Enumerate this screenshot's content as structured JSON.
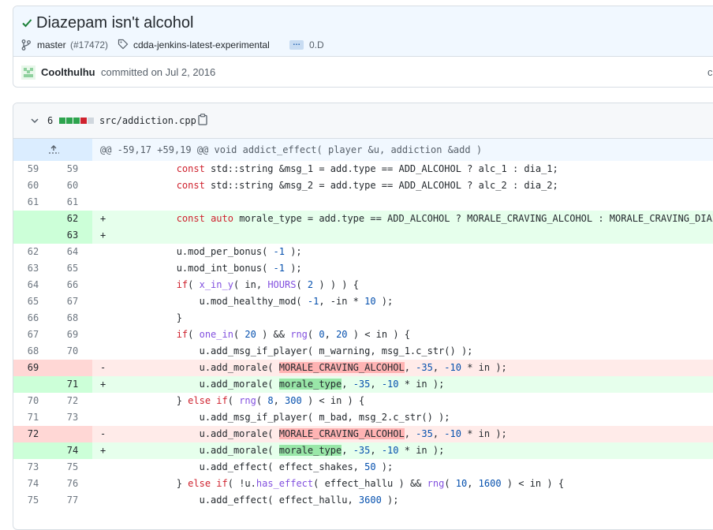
{
  "commit": {
    "title": "Diazepam isn't alcohol",
    "branch": "master",
    "pr": "(#17472)",
    "tag": "cdda-jenkins-latest-experimental",
    "ellipsis": "…",
    "version": "0.D",
    "author": "Coolthulhu",
    "committed_text": "committed on Jul 2, 2016",
    "cut_text": "co"
  },
  "file": {
    "change_count": "6",
    "path": "src/addiction.cpp",
    "diffstat": [
      "add",
      "add",
      "add",
      "del",
      "neutral"
    ]
  },
  "hunk": {
    "header": "@@ -59,17 +59,19 @@ void addict_effect( player &u, addiction &add )"
  },
  "lines": [
    {
      "old": "59",
      "new": "59",
      "type": "ctx",
      "marker": ""
    },
    {
      "old": "60",
      "new": "60",
      "type": "ctx",
      "marker": ""
    },
    {
      "old": "61",
      "new": "61",
      "type": "ctx",
      "marker": ""
    },
    {
      "old": "",
      "new": "62",
      "type": "add",
      "marker": "+"
    },
    {
      "old": "",
      "new": "63",
      "type": "add",
      "marker": "+"
    },
    {
      "old": "62",
      "new": "64",
      "type": "ctx",
      "marker": ""
    },
    {
      "old": "63",
      "new": "65",
      "type": "ctx",
      "marker": ""
    },
    {
      "old": "64",
      "new": "66",
      "type": "ctx",
      "marker": ""
    },
    {
      "old": "65",
      "new": "67",
      "type": "ctx",
      "marker": ""
    },
    {
      "old": "66",
      "new": "68",
      "type": "ctx",
      "marker": ""
    },
    {
      "old": "67",
      "new": "69",
      "type": "ctx",
      "marker": ""
    },
    {
      "old": "68",
      "new": "70",
      "type": "ctx",
      "marker": ""
    },
    {
      "old": "69",
      "new": "",
      "type": "del",
      "marker": "-"
    },
    {
      "old": "",
      "new": "71",
      "type": "add",
      "marker": "+"
    },
    {
      "old": "70",
      "new": "72",
      "type": "ctx",
      "marker": ""
    },
    {
      "old": "71",
      "new": "73",
      "type": "ctx",
      "marker": ""
    },
    {
      "old": "72",
      "new": "",
      "type": "del",
      "marker": "-"
    },
    {
      "old": "",
      "new": "74",
      "type": "add",
      "marker": "+"
    },
    {
      "old": "73",
      "new": "75",
      "type": "ctx",
      "marker": ""
    },
    {
      "old": "74",
      "new": "76",
      "type": "ctx",
      "marker": ""
    },
    {
      "old": "75",
      "new": "77",
      "type": "ctx",
      "marker": ""
    }
  ],
  "code": {
    "l0": {
      "indent": "            ",
      "kw": "const",
      "rest": " std::string &msg_1 = add.type == ADD_ALCOHOL ? alc_1 : dia_1;"
    },
    "l1": {
      "indent": "            ",
      "kw": "const",
      "rest": " std::string &msg_2 = add.type == ADD_ALCOHOL ? alc_2 : dia_2;"
    },
    "l3": {
      "indent": "            ",
      "kw1": "const",
      "kw2": "auto",
      "rest": " morale_type = add.type == ADD_ALCOHOL ? MORALE_CRAVING_ALCOHOL : MORALE_CRAVING_DIAZEPAM;"
    },
    "l5": {
      "pre": "            u.",
      "fn": "mod_per_bonus",
      "mid": "( ",
      "n1": "-1",
      "post": " );"
    },
    "l6": {
      "pre": "            u.",
      "fn": "mod_int_bonus",
      "mid": "( ",
      "n1": "-1",
      "post": " );"
    },
    "l7": {
      "indent": "            ",
      "kw": "if",
      "a": "( ",
      "fn": "x_in_y",
      "b": "( in, ",
      "fn2": "HOURS",
      "c": "( ",
      "n1": "2",
      "d": " ) ) ) {"
    },
    "l8": {
      "pre": "                u.",
      "fn": "mod_healthy_mod",
      "a": "( ",
      "n1": "-1",
      "b": ", -in * ",
      "n2": "10",
      "c": " );"
    },
    "l9": {
      "text": "            }"
    },
    "l10": {
      "indent": "            ",
      "kw": "if",
      "a": "( ",
      "fn": "one_in",
      "b": "( ",
      "n1": "20",
      "c": " ) && ",
      "fn2": "rng",
      "d": "( ",
      "n2": "0",
      "e": ", ",
      "n3": "20",
      "f": " ) < in ) {"
    },
    "l11": {
      "pre": "                u.",
      "fn": "add_msg_if_player",
      "a": "( m_warning, msg_1.",
      "fn2": "c_str",
      "b": "() );"
    },
    "l12": {
      "pre": "                u.",
      "fn": "add_morale",
      "a": "( ",
      "hl": "MORALE_CRAVING_ALCOHOL",
      "b": ", ",
      "n1": "-35",
      "c": ", ",
      "n2": "-10",
      "d": " * in );"
    },
    "l13": {
      "pre": "                u.",
      "fn": "add_morale",
      "a": "( ",
      "hl": "morale_type",
      "b": ", ",
      "n1": "-35",
      "c": ", ",
      "n2": "-10",
      "d": " * in );"
    },
    "l14": {
      "indent": "            } ",
      "kw": "else",
      "s": " ",
      "kw2": "if",
      "a": "( ",
      "fn": "rng",
      "b": "( ",
      "n1": "8",
      "c": ", ",
      "n2": "300",
      "d": " ) < in ) {"
    },
    "l15": {
      "pre": "                u.",
      "fn": "add_msg_if_player",
      "a": "( m_bad, msg_2.",
      "fn2": "c_str",
      "b": "() );"
    },
    "l16": {
      "pre": "                u.",
      "fn": "add_morale",
      "a": "( ",
      "hl": "MORALE_CRAVING_ALCOHOL",
      "b": ", ",
      "n1": "-35",
      "c": ", ",
      "n2": "-10",
      "d": " * in );"
    },
    "l17": {
      "pre": "                u.",
      "fn": "add_morale",
      "a": "( ",
      "hl": "morale_type",
      "b": ", ",
      "n1": "-35",
      "c": ", ",
      "n2": "-10",
      "d": " * in );"
    },
    "l18": {
      "pre": "                u.",
      "fn": "add_effect",
      "a": "( effect_shakes, ",
      "n1": "50",
      "b": " );"
    },
    "l19": {
      "indent": "            } ",
      "kw": "else",
      "s": " ",
      "kw2": "if",
      "a": "( !u.",
      "fn": "has_effect",
      "b": "( effect_hallu ) && ",
      "fn2": "rng",
      "c": "( ",
      "n1": "10",
      "d": ", ",
      "n2": "1600",
      "e": " ) < in ) {"
    },
    "l20": {
      "pre": "                u.",
      "fn": "add_effect",
      "a": "( effect_hallu, ",
      "n1": "3600",
      "b": " );"
    }
  },
  "colors": {
    "success": "#1a7f37",
    "link": "#0969da",
    "add_bg": "#e6ffec",
    "del_bg": "#ffebe9"
  }
}
